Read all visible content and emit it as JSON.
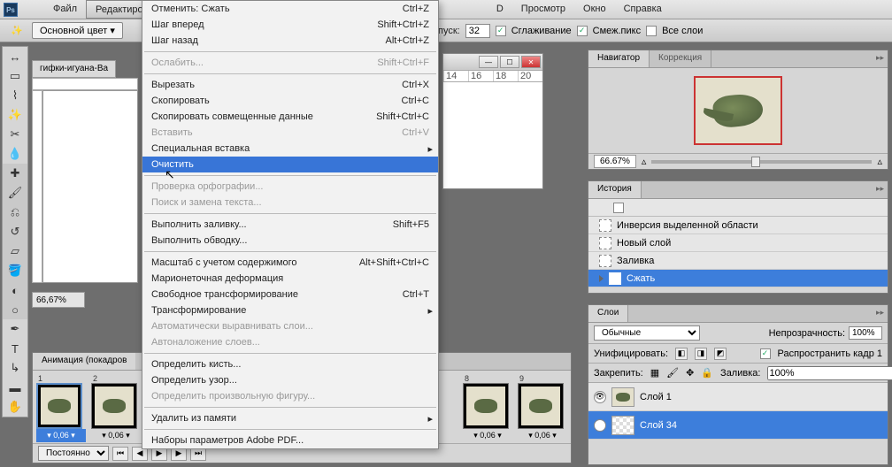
{
  "menubar": {
    "items": [
      "Файл",
      "Редактирование",
      "",
      "",
      "",
      "",
      "",
      "D",
      "Просмотр",
      "Окно",
      "Справка"
    ],
    "active": "Редактирование"
  },
  "optbar": {
    "color_label": "Основной цвет",
    "tolerance_label": "опуск:",
    "tolerance_value": "32",
    "antialias": "Сглаживание",
    "contiguous": "Смеж.пикс",
    "all_layers": "Все слои"
  },
  "dropdown": [
    {
      "label": "Отменить: Сжать",
      "shortcut": "Ctrl+Z",
      "type": "item"
    },
    {
      "label": "Шаг вперед",
      "shortcut": "Shift+Ctrl+Z",
      "type": "item"
    },
    {
      "label": "Шаг назад",
      "shortcut": "Alt+Ctrl+Z",
      "type": "item"
    },
    {
      "type": "sep"
    },
    {
      "label": "Ослабить...",
      "shortcut": "Shift+Ctrl+F",
      "type": "disabled"
    },
    {
      "type": "sep"
    },
    {
      "label": "Вырезать",
      "shortcut": "Ctrl+X",
      "type": "item"
    },
    {
      "label": "Скопировать",
      "shortcut": "Ctrl+C",
      "type": "item"
    },
    {
      "label": "Скопировать совмещенные данные",
      "shortcut": "Shift+Ctrl+C",
      "type": "item"
    },
    {
      "label": "Вставить",
      "shortcut": "Ctrl+V",
      "type": "disabled"
    },
    {
      "label": "Специальная вставка",
      "shortcut": "",
      "type": "submenu"
    },
    {
      "label": "Очистить",
      "shortcut": "",
      "type": "hover"
    },
    {
      "type": "sep"
    },
    {
      "label": "Проверка орфографии...",
      "shortcut": "",
      "type": "disabled"
    },
    {
      "label": "Поиск и замена текста...",
      "shortcut": "",
      "type": "disabled"
    },
    {
      "type": "sep"
    },
    {
      "label": "Выполнить заливку...",
      "shortcut": "Shift+F5",
      "type": "item"
    },
    {
      "label": "Выполнить обводку...",
      "shortcut": "",
      "type": "item"
    },
    {
      "type": "sep"
    },
    {
      "label": "Масштаб с учетом содержимого",
      "shortcut": "Alt+Shift+Ctrl+C",
      "type": "item"
    },
    {
      "label": "Марионеточная деформация",
      "shortcut": "",
      "type": "item"
    },
    {
      "label": "Свободное трансформирование",
      "shortcut": "Ctrl+T",
      "type": "item"
    },
    {
      "label": "Трансформирование",
      "shortcut": "",
      "type": "submenu"
    },
    {
      "label": "Автоматически выравнивать слои...",
      "shortcut": "",
      "type": "disabled"
    },
    {
      "label": "Автоналожение слоев...",
      "shortcut": "",
      "type": "disabled"
    },
    {
      "type": "sep"
    },
    {
      "label": "Определить кисть...",
      "shortcut": "",
      "type": "item"
    },
    {
      "label": "Определить узор...",
      "shortcut": "",
      "type": "item"
    },
    {
      "label": "Определить произвольную фигуру...",
      "shortcut": "",
      "type": "disabled"
    },
    {
      "type": "sep"
    },
    {
      "label": "Удалить из памяти",
      "shortcut": "",
      "type": "submenu"
    },
    {
      "type": "sep"
    },
    {
      "label": "Наборы параметров Adobe PDF...",
      "shortcut": "",
      "type": "item"
    }
  ],
  "doc": {
    "tab": "гифки-игуана-Ba",
    "zoom": "66,67%"
  },
  "docwin": {
    "rulers": [
      "14",
      "16",
      "18",
      "20"
    ]
  },
  "navigator": {
    "tab1": "Навигатор",
    "tab2": "Коррекция",
    "zoom": "66.67%"
  },
  "history": {
    "tab": "История",
    "steps": [
      "Инверсия выделенной области",
      "Новый слой",
      "Заливка",
      "Сжать"
    ],
    "selected": 3
  },
  "layers": {
    "tab": "Слои",
    "blend": "Обычные",
    "opacity_label": "Непрозрачность:",
    "opacity": "100%",
    "unify": "Унифицировать:",
    "propagate": "Распространить кадр 1",
    "lock_label": "Закрепить:",
    "fill_label": "Заливка:",
    "fill": "100%",
    "items": [
      {
        "name": "Слой 1",
        "sel": false
      },
      {
        "name": "Слой 34",
        "sel": true
      }
    ]
  },
  "animation": {
    "tab": "Анимация (покадров",
    "loop": "Постоянно",
    "frames": [
      {
        "n": "1",
        "t": "0,06",
        "sel": true
      },
      {
        "n": "2",
        "t": "0,06"
      },
      {
        "n": "8",
        "t": "0,06"
      },
      {
        "n": "9",
        "t": "0,06"
      }
    ]
  }
}
